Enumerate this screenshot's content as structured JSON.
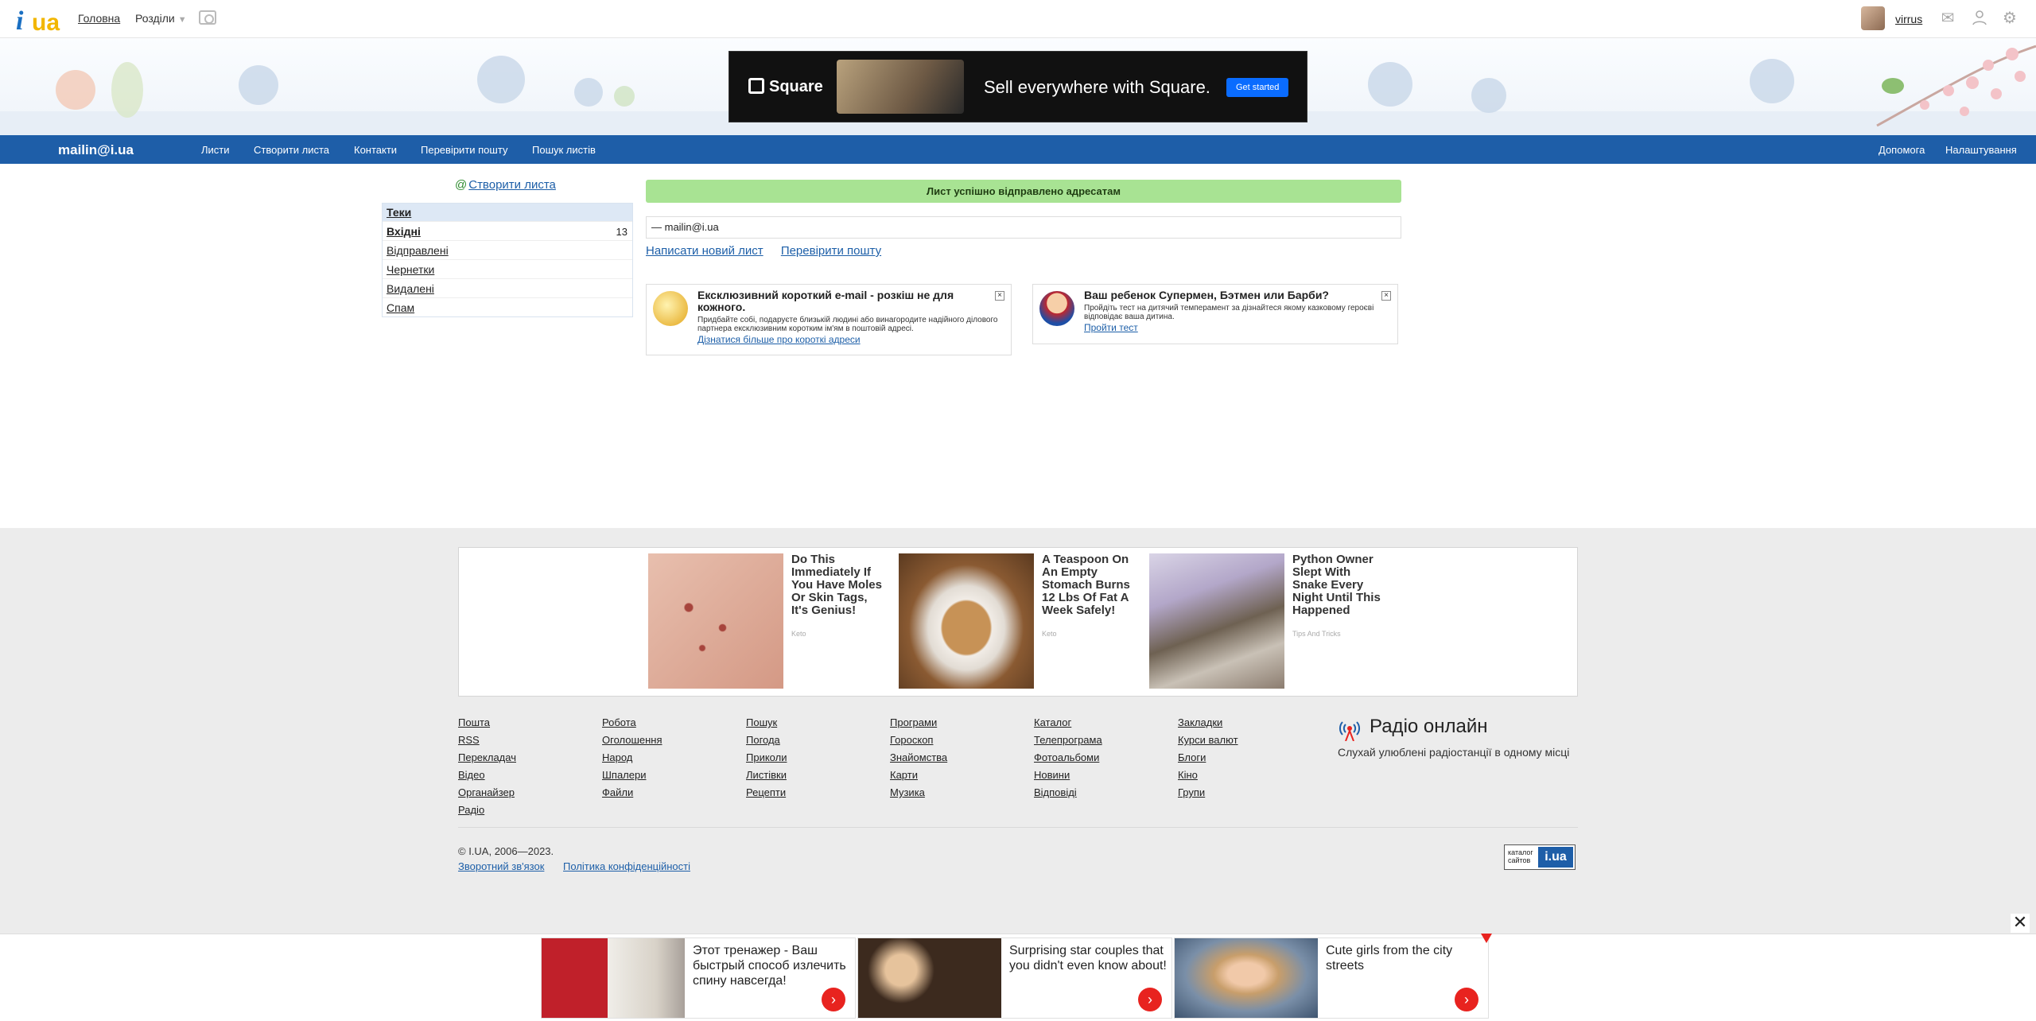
{
  "topbar": {
    "logo_i": "i",
    "logo_ua": "ua",
    "home": "Головна",
    "sections": "Розділи",
    "username": "virrus"
  },
  "banner_ad": {
    "brand": "Square",
    "headline": "Sell everywhere with Square.",
    "cta": "Get started"
  },
  "mailbar": {
    "brand": "mailin@i.ua",
    "nav": [
      "Листи",
      "Створити листа",
      "Контакти",
      "Перевірити пошту",
      "Пошук листів"
    ],
    "help": "Допомога",
    "settings": "Налаштування"
  },
  "sidebar": {
    "create": "Створити листа",
    "folders_title": "Теки",
    "folders": [
      {
        "label": "Вхідні",
        "count": "13"
      },
      {
        "label": "Відправлені",
        "count": ""
      },
      {
        "label": "Чернетки",
        "count": ""
      },
      {
        "label": "Видалені",
        "count": ""
      },
      {
        "label": "Спам",
        "count": ""
      }
    ]
  },
  "main": {
    "success": "Лист успішно відправлено адресатам",
    "recipient": "— mailin@i.ua",
    "write_new": "Написати новий лист",
    "check_mail": "Перевірити пошту"
  },
  "promos": [
    {
      "title": "Ексклюзивний короткий e-mail - розкіш не для кожного.",
      "text": "Придбайте собі, подаруєте близькій людині або винагородите надійного ділового партнера ексклюзивним коротким ім'ям в поштовій адресі.",
      "link": "Дізнатися більше про короткі адреси"
    },
    {
      "title": "Ваш ребенок Супермен, Бэтмен или Барби?",
      "text": "Пройдіть тест на дитячий темперамент за дізнайтеся якому казковому героєві відповідає ваша дитина.",
      "link": "Пройти тест"
    }
  ],
  "native_ads": [
    {
      "title": "Do This Immediately If You Have Moles Or Skin Tags, It's Genius!",
      "source": "Keto"
    },
    {
      "title": "A Teaspoon On An Empty Stomach Burns 12 Lbs Of Fat A Week Safely!",
      "source": "Keto"
    },
    {
      "title": "Python Owner Slept With Snake Every Night Until This Happened",
      "source": "Tips And Tricks"
    }
  ],
  "footer": {
    "columns": [
      [
        "Пошта",
        "RSS",
        "Перекладач",
        "Відео",
        "Органайзер",
        "Радіо"
      ],
      [
        "Робота",
        "Оголошення",
        "Народ",
        "Шпалери",
        "Файли"
      ],
      [
        "Пошук",
        "Погода",
        "Приколи",
        "Листівки",
        "Рецепти"
      ],
      [
        "Програми",
        "Гороскоп",
        "Знайомства",
        "Карти",
        "Музика"
      ],
      [
        "Каталог",
        "Телепрограма",
        "Фотоальбоми",
        "Новини",
        "Відповіді"
      ],
      [
        "Закладки",
        "Курси валют",
        "Блоги",
        "Кіно",
        "Групи"
      ]
    ],
    "radio_title": "Радіо онлайн",
    "radio_desc": "Слухай улюблені радіостанції в одному місці",
    "copyright": "© I.UA, 2006—2023.",
    "feedback": "Зворотний зв'язок",
    "privacy": "Політика конфіденційності",
    "catalog_text": "каталог сайтов",
    "catalog_logo": "i.ua"
  },
  "sticky_ads": [
    {
      "title": "Этот тренажер - Ваш быстрый способ излечить спину навсегда!"
    },
    {
      "title": "Surprising star couples that you didn't even know about!"
    },
    {
      "title": "Cute girls from the city streets"
    }
  ]
}
